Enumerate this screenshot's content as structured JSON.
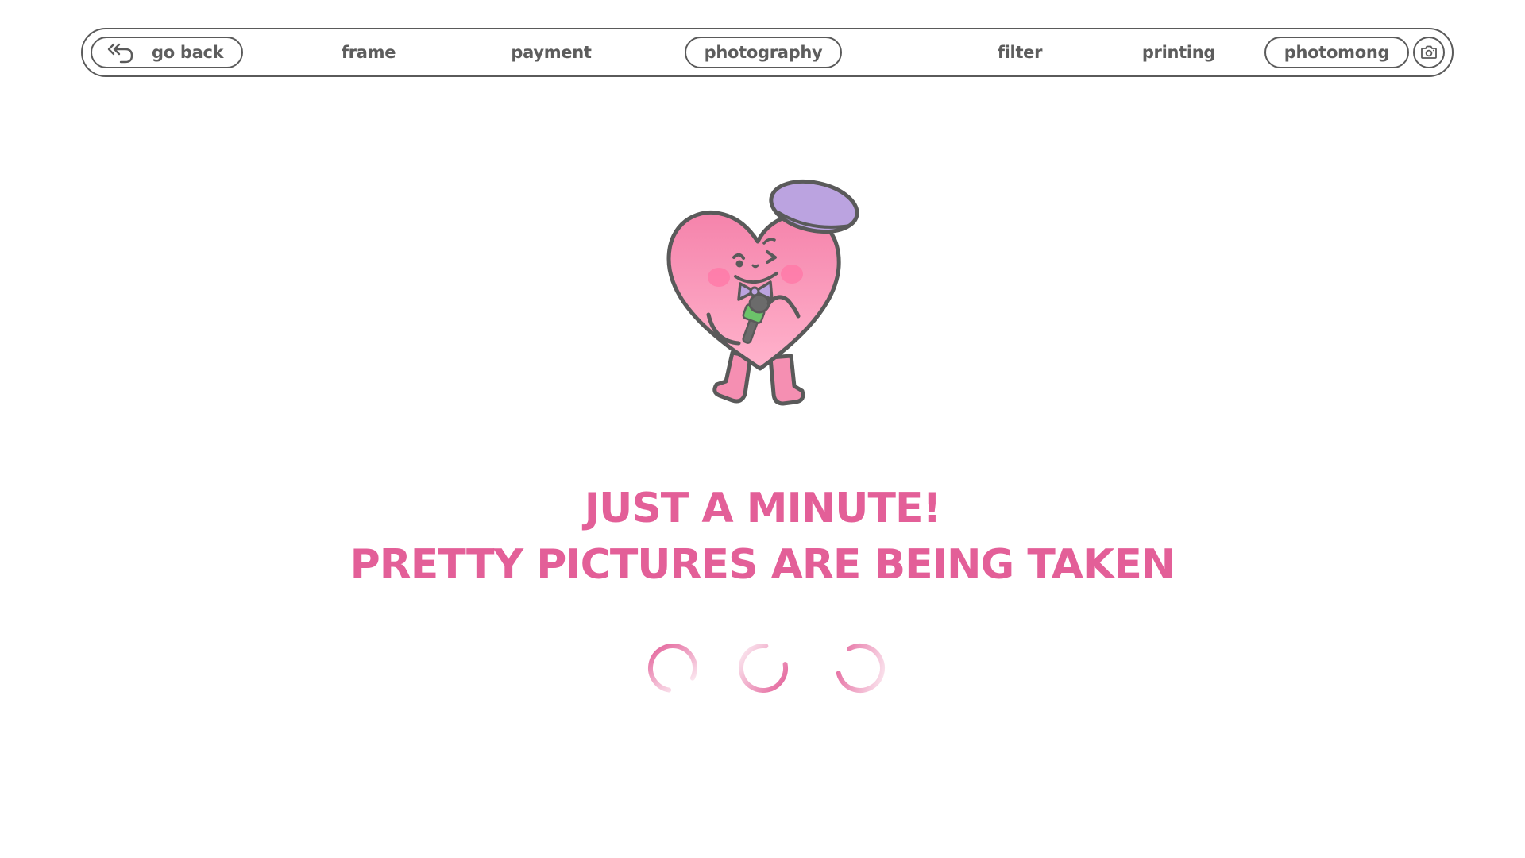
{
  "nav": {
    "back_label": "go back",
    "steps": [
      "frame",
      "payment",
      "photography",
      "filter",
      "printing",
      "photomong"
    ],
    "active_step": "photography",
    "icons": {
      "back": "back-arrow-icon",
      "camera": "camera-icon"
    }
  },
  "main": {
    "mascot": "heart-mascot",
    "heading_line_1": "JUST A MINUTE!",
    "heading_line_2": "PRETTY PICTURES ARE BEING TAKEN",
    "loader_count": 3
  },
  "colors": {
    "accent_pink": "#e35f98",
    "text_gray": "#5d5d5d",
    "outline_gray": "#5a5a5a",
    "heart_pink": "#f58fb2",
    "hat_purple": "#bba3e0",
    "mic_green": "#6cc36a",
    "background": "#ffffff"
  }
}
